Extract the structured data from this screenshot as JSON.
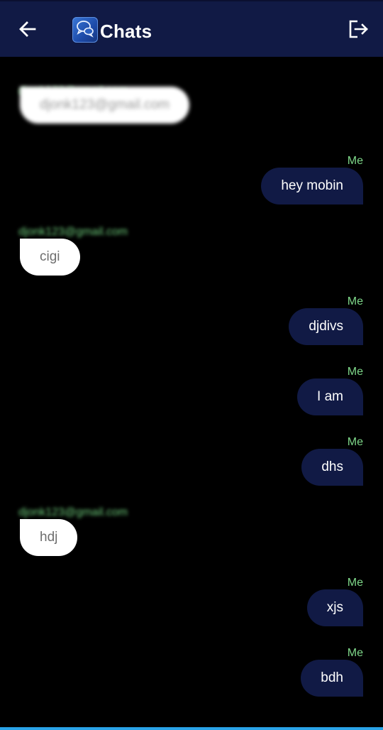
{
  "app": {
    "title": "Chats",
    "brand_color": "#111a45",
    "background_color": "#000000",
    "sender_label_color": "#7fd98a",
    "icons": {
      "back": "arrow-left-icon",
      "logo": "chat-bubbles-logo-icon",
      "logout": "logout-icon"
    }
  },
  "messages": [
    {
      "sender": "djonk123@gmail.com",
      "text": "djonk123@gmail.com",
      "mine": false,
      "blurred": true
    },
    {
      "sender": "Me",
      "text": "hey mobin",
      "mine": true,
      "blurred": false
    },
    {
      "sender": "djonk123@gmail.com",
      "text": "cigi",
      "mine": false,
      "blurred": false
    },
    {
      "sender": "Me",
      "text": "djdivs",
      "mine": true,
      "blurred": false
    },
    {
      "sender": "Me",
      "text": "I am",
      "mine": true,
      "blurred": false
    },
    {
      "sender": "Me",
      "text": "dhs",
      "mine": true,
      "blurred": false
    },
    {
      "sender": "djonk123@gmail.com",
      "text": "hdj",
      "mine": false,
      "blurred": false
    },
    {
      "sender": "Me",
      "text": "xjs",
      "mine": true,
      "blurred": false
    },
    {
      "sender": "Me",
      "text": "bdh",
      "mine": true,
      "blurred": false
    }
  ]
}
